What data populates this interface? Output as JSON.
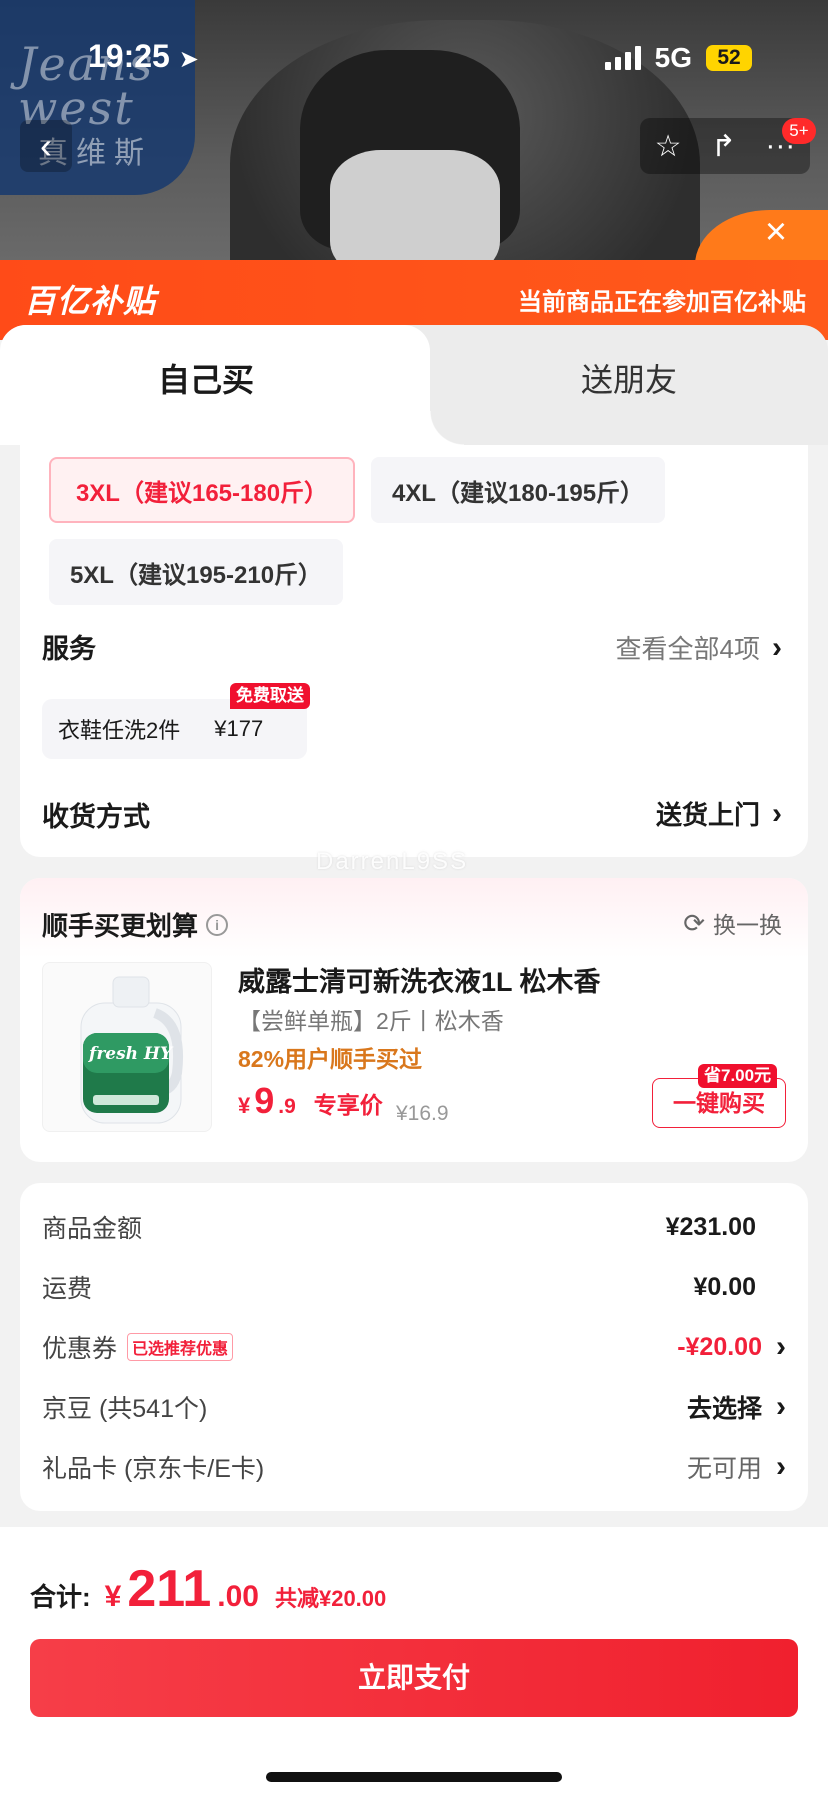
{
  "status_bar": {
    "time": "19:25",
    "network": "5G",
    "battery": "52"
  },
  "brand": {
    "name": "Jeans west",
    "name_cn": "真维斯"
  },
  "nav": {
    "cart_badge": "5+"
  },
  "banner": {
    "logo": "百亿补贴",
    "message": "当前商品正在参加百亿补贴"
  },
  "tabs": [
    {
      "label": "自己买"
    },
    {
      "label": "送朋友"
    }
  ],
  "sizes": [
    {
      "label": "3XL（建议165-180斤）"
    },
    {
      "label": "4XL（建议180-195斤）"
    },
    {
      "label": "5XL（建议195-210斤）"
    }
  ],
  "service": {
    "label": "服务",
    "view_all": "查看全部4项",
    "chip": {
      "name": "衣鞋任洗2件",
      "price": "¥177",
      "tag": "免费取送"
    }
  },
  "delivery": {
    "label": "收货方式",
    "value": "送货上门"
  },
  "watermark": "DarrenL9SS",
  "addon": {
    "title": "顺手买更划算",
    "swap": "换一换",
    "product": {
      "name": "威露士清可新洗衣液1L 松木香",
      "spec": "【尝鲜单瓶】2斤丨松木香",
      "bought": "82%用户顺手买过",
      "price_currency": "¥",
      "price_int": "9",
      "price_dec": ".9",
      "price_label": "专享价",
      "original_price": "¥16.9",
      "save_tag": "省7.00元",
      "buy_label": "一键购买",
      "image_text": "fresh HY"
    }
  },
  "summary": {
    "items": [
      {
        "label": "商品金额",
        "value": "¥231.00"
      },
      {
        "label": "运费",
        "value": "¥0.00"
      },
      {
        "label": "优惠券",
        "tag": "已选推荐优惠",
        "value": "-¥20.00"
      },
      {
        "label": "京豆 (共541个)",
        "value": "去选择"
      },
      {
        "label": "礼品卡 (京东卡/E卡)",
        "value": "无可用"
      }
    ]
  },
  "bottom": {
    "total_label": "合计:",
    "currency": "¥",
    "total_int": "211",
    "total_dec": ".00",
    "discount": "共减¥20.00",
    "pay_label": "立即支付"
  },
  "colors": {
    "accent": "#f2203a",
    "banner": "#ff4b18",
    "gold_text": "#d9771c"
  }
}
